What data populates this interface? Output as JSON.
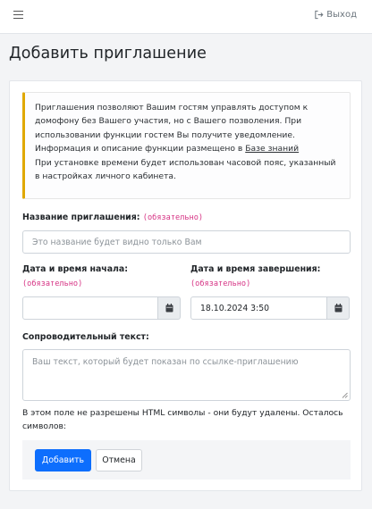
{
  "header": {
    "menu_icon": "hamburger-icon",
    "logout_icon": "logout-icon",
    "logout_label": "Выход"
  },
  "page": {
    "title": "Добавить приглашение"
  },
  "alert": {
    "text_1": "Приглашения позволяют Вашим гостям управлять доступом к домофону без Вашего участия, но с Вашего позволения. При использовании функции гостем Вы получите уведомление. Информация и описание функции размещено в ",
    "link": "Базе знаний",
    "text_2": "При установке времени будет использован часовой пояс, указанный в настройках личного кабинета.",
    "accent_color": "#e0a800"
  },
  "form": {
    "name": {
      "label": "Название приглашения:",
      "required": "(обязательно)",
      "placeholder": "Это название будет видно только Вам",
      "value": ""
    },
    "start": {
      "label": "Дата и время начала:",
      "required": "(обязательно)",
      "value": "",
      "icon": "calendar-icon"
    },
    "end": {
      "label": "Дата и время завершения:",
      "required": "(обязательно)",
      "value": "18.10.2024 3:50",
      "icon": "calendar-icon"
    },
    "text": {
      "label": "Сопроводительный текст:",
      "placeholder": "Ваш текст, который будет показан по ссылке-приглашению"
    },
    "help": "В этом поле не разрешены HTML символы - они будут удалены. Осталось символов:",
    "submit_label": "Добавить",
    "cancel_label": "Отмена",
    "primary_color": "#0d6efd",
    "required_color": "#d63384"
  }
}
